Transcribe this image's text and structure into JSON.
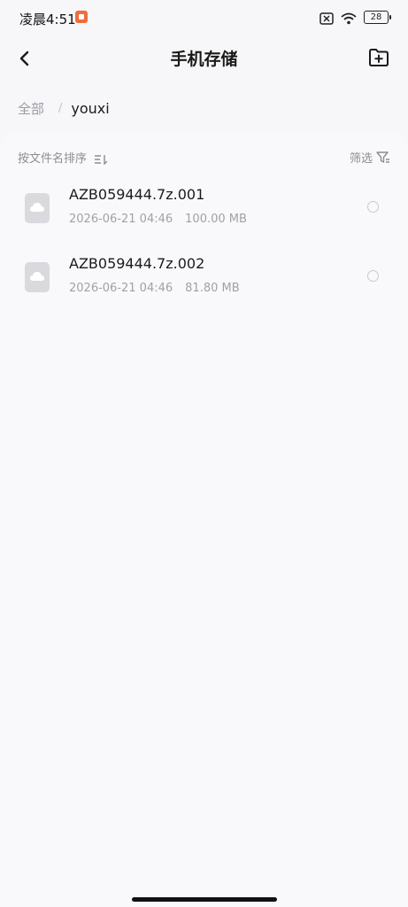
{
  "status_bar": {
    "time": "凌晨4:51",
    "battery": "28"
  },
  "header": {
    "title": "手机存储"
  },
  "breadcrumb": {
    "root": "全部",
    "separator": "/",
    "current": "youxi"
  },
  "sort_bar": {
    "sort_label": "按文件名排序",
    "filter_label": "筛选"
  },
  "files": [
    {
      "name": "AZB059444.7z.001",
      "date": "2026-06-21 04:46",
      "size": "100.00 MB"
    },
    {
      "name": "AZB059444.7z.002",
      "date": "2026-06-21 04:46",
      "size": "81.80 MB"
    }
  ],
  "icons": {
    "back": "chevron-left-icon",
    "new_folder": "folder-plus-icon",
    "sort": "sort-icon",
    "filter": "filter-icon",
    "file": "cloud-file-icon"
  },
  "colors": {
    "background": "#f7f7f9",
    "app_badge": "#f26b3a",
    "secondary_text": "#a0a0a8"
  }
}
